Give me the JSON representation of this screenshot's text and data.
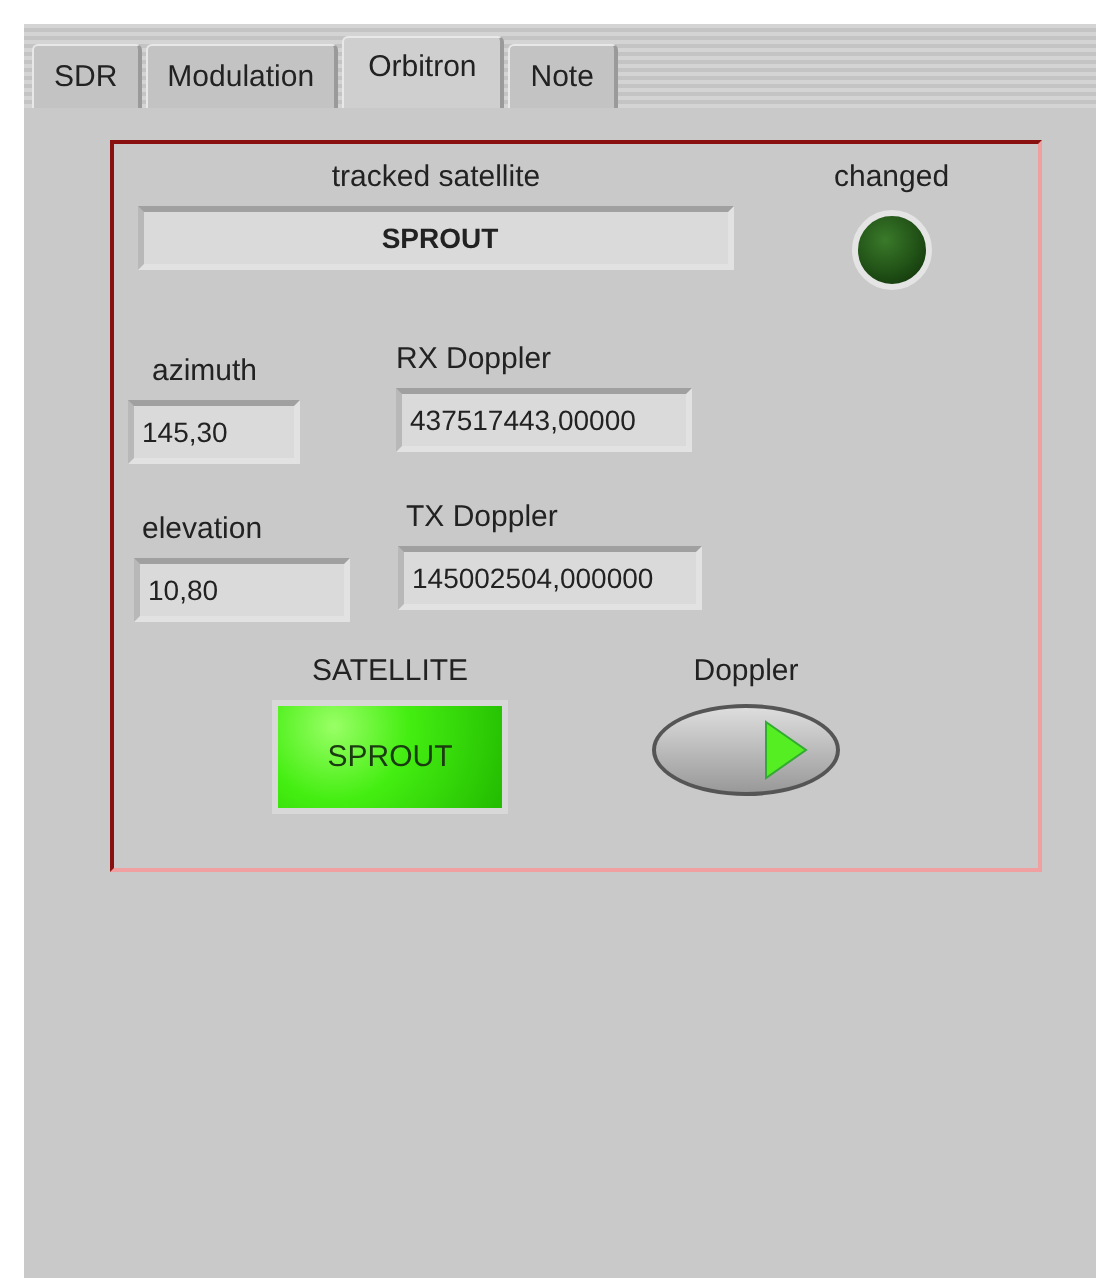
{
  "tabs": [
    {
      "label": "SDR",
      "selected": false
    },
    {
      "label": "Modulation",
      "selected": false
    },
    {
      "label": "Orbitron",
      "selected": true
    },
    {
      "label": "Note",
      "selected": false
    }
  ],
  "tracked_satellite": {
    "label": "tracked satellite",
    "value": "SPROUT"
  },
  "changed": {
    "label": "changed",
    "on": false
  },
  "azimuth": {
    "label": "azimuth",
    "value": "145,30"
  },
  "rx_doppler": {
    "label": "RX Doppler",
    "value": "437517443,00000"
  },
  "elevation": {
    "label": "elevation",
    "value": "10,80"
  },
  "tx_doppler": {
    "label": "TX Doppler",
    "value": "145002504,000000"
  },
  "satellite": {
    "label": "SATELLITE",
    "value": "SPROUT",
    "on": true
  },
  "doppler": {
    "label": "Doppler",
    "on": true
  }
}
